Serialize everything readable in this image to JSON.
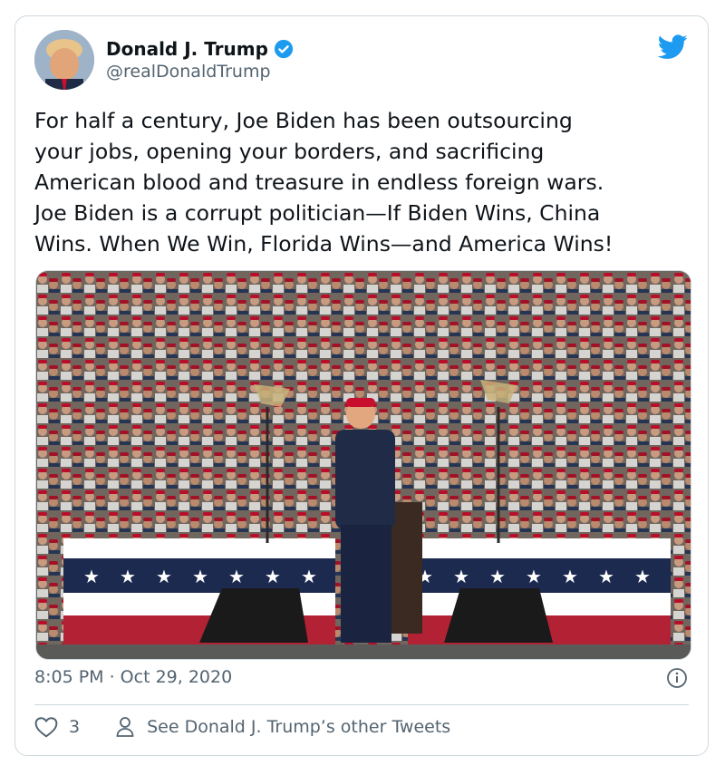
{
  "author": {
    "name": "Donald J. Trump",
    "handle": "@realDonaldTrump",
    "verified": true
  },
  "tweet": {
    "text": "For half a century, Joe Biden has been outsourcing\nyour jobs, opening your borders, and sacrificing\nAmerican blood and treasure in endless foreign wars.\nJoe Biden is a corrupt politician—If Biden Wins, China\nWins. When We Win, Florida Wins—and America Wins!",
    "timestamp": "8:05 PM · Oct 29, 2020"
  },
  "actions": {
    "likes": "3",
    "other_tweets_label": "See Donald J. Trump’s other Tweets"
  },
  "icons": {
    "brand": "twitter-bird-icon",
    "verified": "verified-badge-icon",
    "info": "info-icon",
    "like": "heart-icon",
    "profile": "person-icon"
  },
  "colors": {
    "twitter_blue": "#1d9bf0",
    "text": "#0f1419",
    "muted": "#536471",
    "border": "#cfd9de",
    "bunting_red": "#b22234",
    "bunting_navy": "#1c2a4f"
  }
}
